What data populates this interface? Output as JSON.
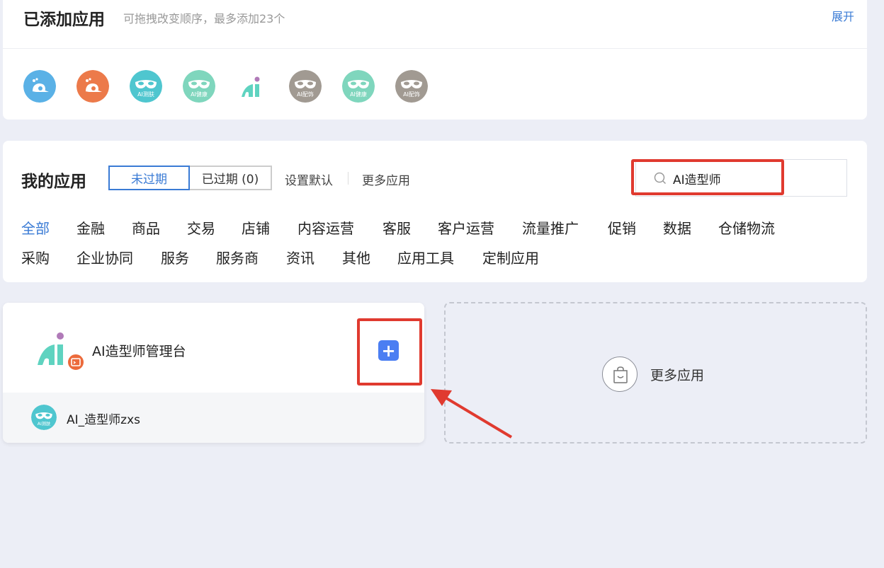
{
  "added_apps": {
    "title": "已添加应用",
    "hint": "可拖拽改变顺序，最多添加23个",
    "expand_label": "展开",
    "icons": [
      {
        "name": "snail-blue-icon",
        "color": "#5ab1e6",
        "label": ""
      },
      {
        "name": "snail-orange-icon",
        "color": "#ec7a4a",
        "label": ""
      },
      {
        "name": "mask-teal-icon",
        "color": "#4fc6cf",
        "label": "AI测肤"
      },
      {
        "name": "mask-mint-icon",
        "color": "#7fd6bd",
        "label": "AI健康"
      },
      {
        "name": "ai-stylist-logo-icon",
        "color": "#ffffff",
        "label": ""
      },
      {
        "name": "mask-gray-icon",
        "color": "#a19a92",
        "label": "AI配饰"
      },
      {
        "name": "mask-mint-icon-2",
        "color": "#7fd6bd",
        "label": "AI健康"
      },
      {
        "name": "mask-gray-icon-2",
        "color": "#a19a92",
        "label": "AI配饰"
      }
    ]
  },
  "my_apps": {
    "title": "我的应用",
    "tab_active": "未过期",
    "tab_expired": "已过期 (0)",
    "set_default": "设置默认",
    "more_apps": "更多应用",
    "search_value": "AI造型师",
    "categories_row1": [
      "全部",
      "金融",
      "商品",
      "交易",
      "店铺",
      "内容运营",
      "客服",
      "客户运营",
      "流量推广",
      "促销",
      "数据",
      "仓储物流"
    ],
    "categories_row2": [
      "采购",
      "企业协同",
      "服务",
      "服务商",
      "资讯",
      "其他",
      "应用工具",
      "定制应用"
    ]
  },
  "result": {
    "app_name": "AI造型师管理台",
    "add_symbol": "+",
    "sub_app_name": "AI_造型师zxs",
    "sub_icon_label": "AI测肤"
  },
  "more_card": {
    "label": "更多应用"
  },
  "colors": {
    "accent": "#3a7bd5",
    "add_button": "#4b7ef2",
    "annotation_red": "#e03a2f"
  }
}
